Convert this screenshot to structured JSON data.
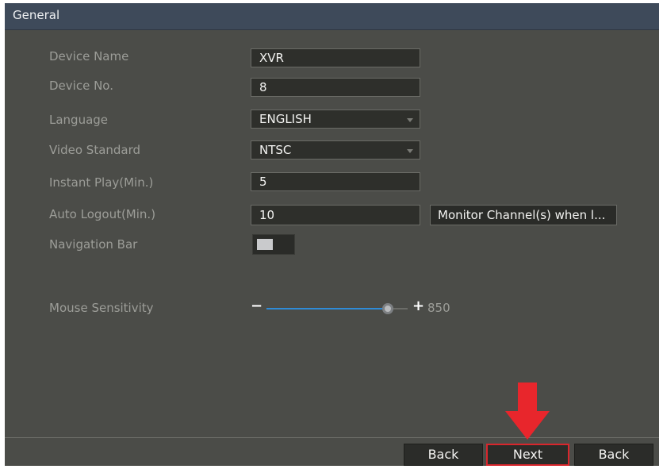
{
  "window": {
    "title": "General"
  },
  "fields": {
    "device_name": {
      "label": "Device Name",
      "value": "XVR"
    },
    "device_no": {
      "label": "Device No.",
      "value": "8"
    },
    "language": {
      "label": "Language",
      "value": "ENGLISH"
    },
    "video_standard": {
      "label": "Video Standard",
      "value": "NTSC"
    },
    "instant_play": {
      "label": "Instant Play(Min.)",
      "value": "5"
    },
    "auto_logout": {
      "label": "Auto Logout(Min.)",
      "value": "10"
    },
    "monitor_channels_button": "Monitor Channel(s) when l...",
    "navigation_bar": {
      "label": "Navigation Bar",
      "enabled": false
    },
    "mouse_sensitivity": {
      "label": "Mouse Sensitivity",
      "minus_symbol": "−",
      "plus_symbol": "+",
      "value": "850",
      "level_fraction": 0.86
    }
  },
  "footer": {
    "back_label": "Back",
    "next_label": "Next",
    "back2_label": "Back"
  },
  "colors": {
    "accent": "#2f8bd6",
    "annotation": "#e8262c"
  }
}
